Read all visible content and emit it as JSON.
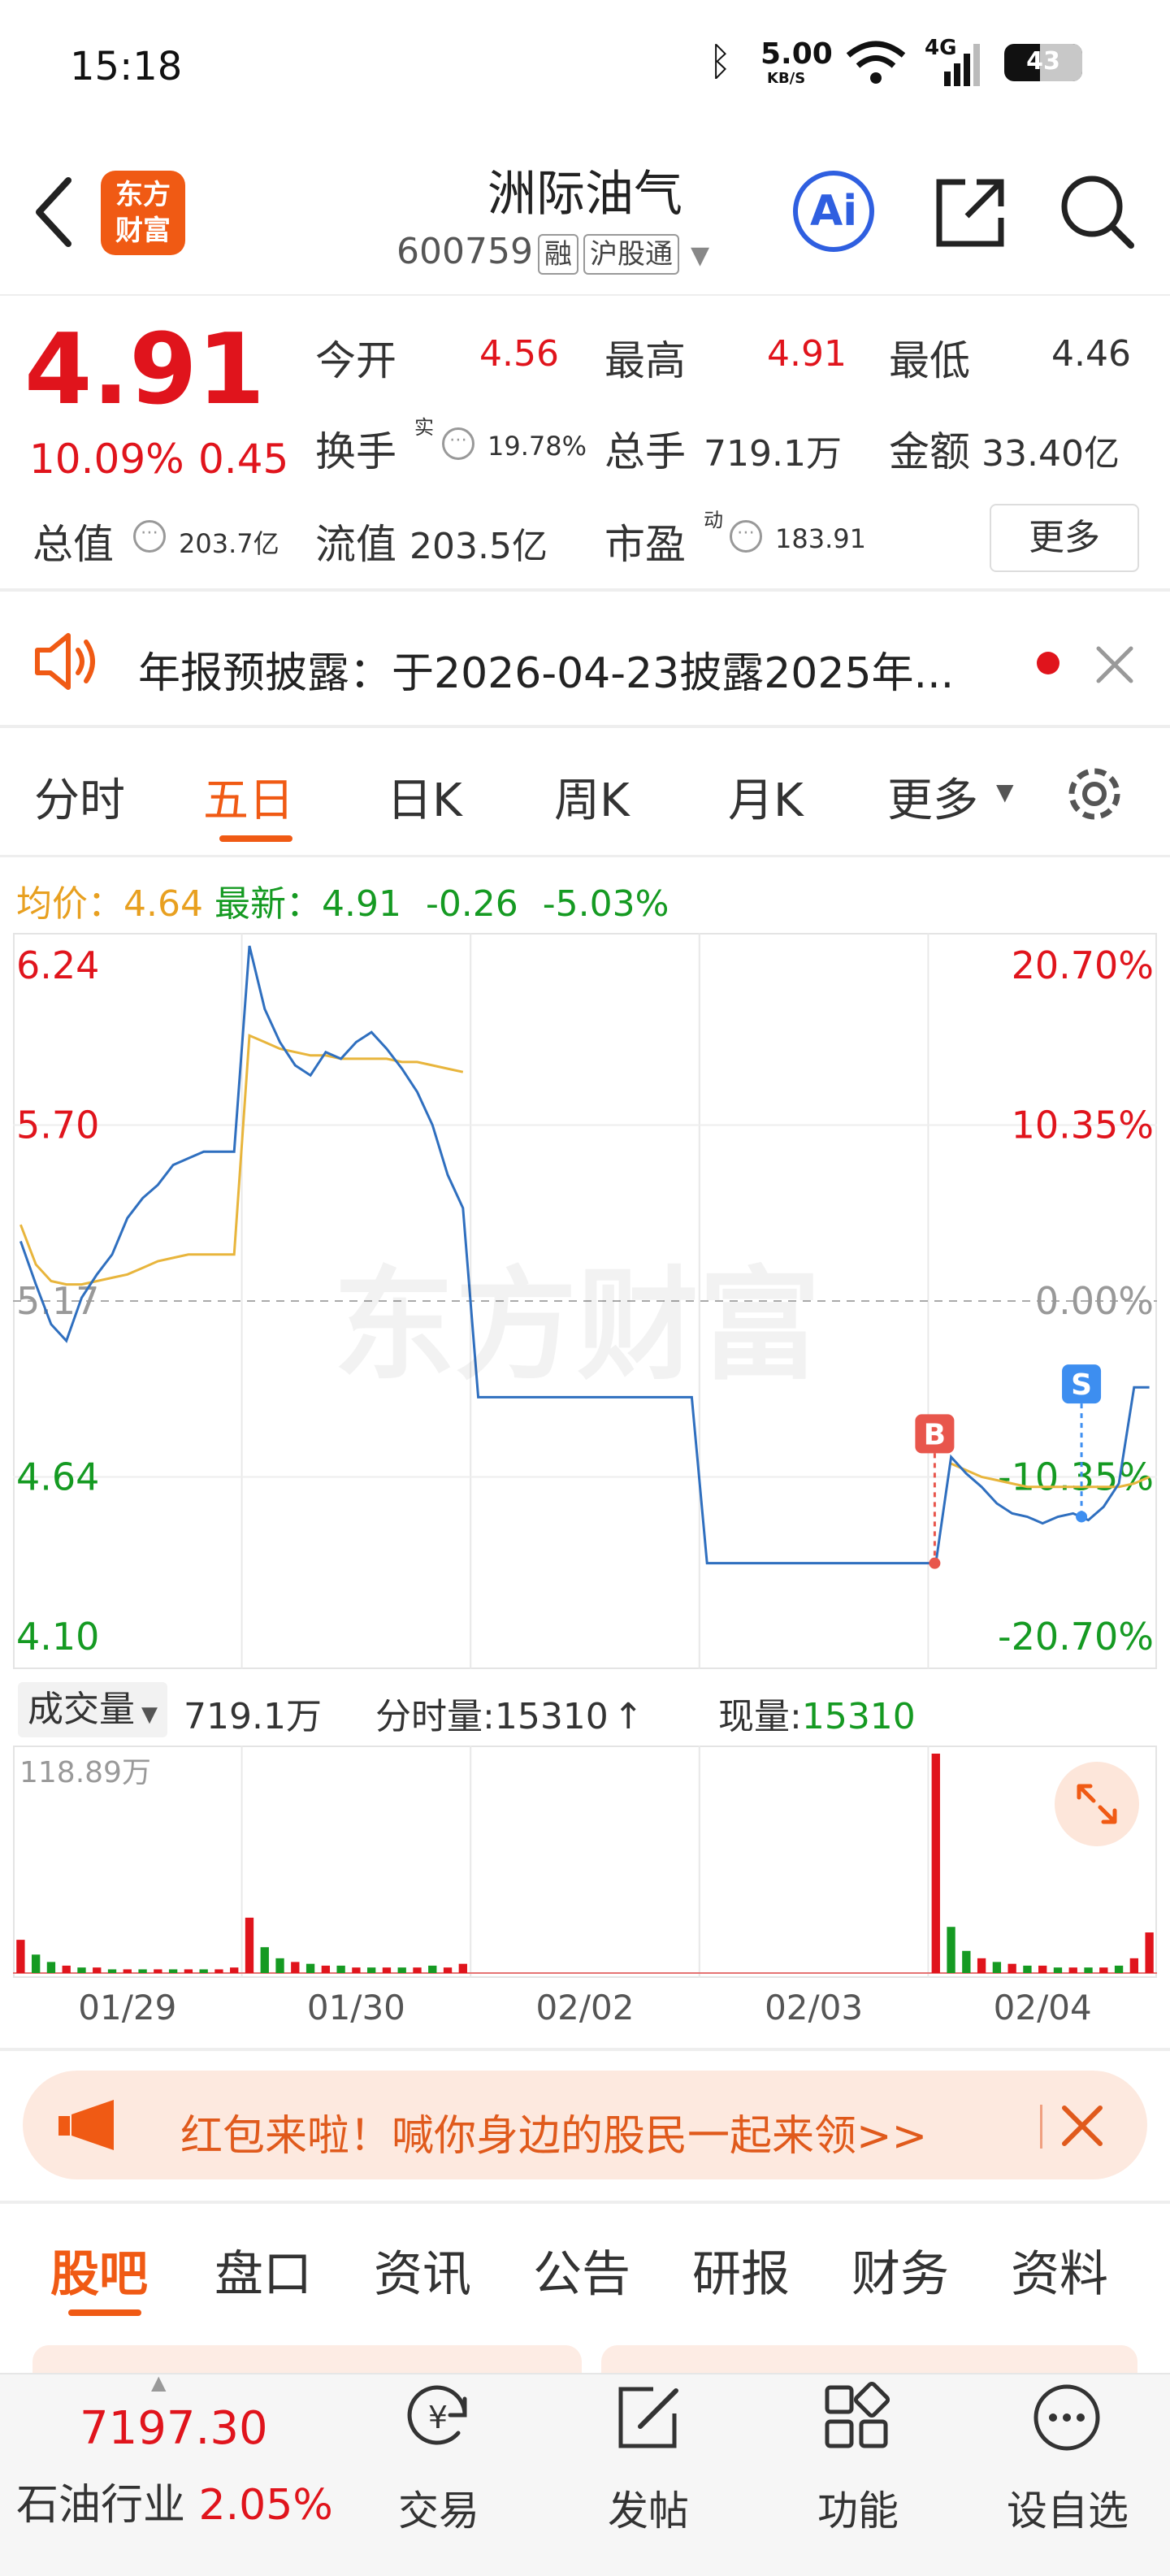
{
  "status_bar": {
    "time": "15:18",
    "net_speed": "5.00",
    "net_unit": "KB/S",
    "signal": "4G",
    "battery": "43"
  },
  "header": {
    "logo": "东方\n财富",
    "stock_name": "洲际油气",
    "stock_code": "600759",
    "badge_1": "融",
    "badge_2": "沪股通",
    "ai_label": "Ai"
  },
  "quote": {
    "price": "4.91",
    "change_pct": "10.09%",
    "change_amt": "0.45",
    "open_label": "今开",
    "open": "4.56",
    "high_label": "最高",
    "high": "4.91",
    "low_label": "最低",
    "low": "4.46",
    "turnover_label": "换手",
    "turnover_sup": "实",
    "turnover": "19.78%",
    "volume_label": "总手",
    "volume": "719.1万",
    "amount_label": "金额",
    "amount": "33.40亿",
    "mktcap_label": "总值",
    "mktcap": "203.7亿",
    "float_label": "流值",
    "float_cap": "203.5亿",
    "pe_label": "市盈",
    "pe_sup": "动",
    "pe": "183.91",
    "more_label": "更多"
  },
  "notice": {
    "text": "年报预披露：于2026-04-23披露2025年..."
  },
  "chart_tabs": [
    "分时",
    "五日",
    "日K",
    "周K",
    "月K",
    "更多"
  ],
  "active_tab": "五日",
  "chart_info": {
    "avg_label": "均价：",
    "avg": "4.64",
    "latest_label": "最新：",
    "latest": "4.91",
    "change": "-0.26",
    "change_pct": "-5.03%"
  },
  "chart_data": {
    "type": "line",
    "title": "",
    "days": [
      "01/29",
      "01/30",
      "02/02",
      "02/03",
      "02/04"
    ],
    "price_axis": [
      "6.24",
      "5.70",
      "5.17",
      "4.64",
      "4.10"
    ],
    "pct_axis": [
      "20.70%",
      "10.35%",
      "0.00%",
      "-10.35%",
      "-20.70%"
    ],
    "ylim": [
      4.1,
      6.24
    ],
    "reference_price": 5.17,
    "series": [
      {
        "name": "价格",
        "values": [
          5.35,
          5.22,
          5.1,
          5.05,
          5.18,
          5.25,
          5.31,
          5.42,
          5.48,
          5.52,
          5.58,
          5.6,
          5.62,
          5.62,
          5.62,
          6.24,
          6.05,
          5.95,
          5.88,
          5.85,
          5.92,
          5.9,
          5.95,
          5.98,
          5.93,
          5.87,
          5.8,
          5.7,
          5.55,
          5.45,
          4.88,
          4.88,
          4.88,
          4.88,
          4.88,
          4.88,
          4.88,
          4.88,
          4.88,
          4.88,
          4.88,
          4.88,
          4.88,
          4.88,
          4.88,
          4.38,
          4.38,
          4.38,
          4.38,
          4.38,
          4.38,
          4.38,
          4.38,
          4.38,
          4.38,
          4.38,
          4.38,
          4.38,
          4.38,
          4.38,
          4.38,
          4.7,
          4.65,
          4.61,
          4.56,
          4.53,
          4.52,
          4.5,
          4.52,
          4.53,
          4.51,
          4.55,
          4.62,
          4.91,
          4.91
        ]
      },
      {
        "name": "均价",
        "values": [
          5.4,
          5.28,
          5.23,
          5.22,
          5.22,
          5.23,
          5.24,
          5.25,
          5.27,
          5.29,
          5.3,
          5.31,
          5.31,
          5.31,
          5.31,
          5.97,
          5.95,
          5.93,
          5.92,
          5.91,
          5.91,
          5.9,
          5.9,
          5.9,
          5.9,
          5.89,
          5.89,
          5.88,
          5.87,
          5.86,
          null,
          null,
          null,
          null,
          null,
          null,
          null,
          null,
          null,
          null,
          null,
          null,
          null,
          null,
          null,
          null,
          null,
          null,
          null,
          null,
          null,
          null,
          null,
          null,
          null,
          null,
          null,
          null,
          null,
          null,
          null,
          4.68,
          4.66,
          4.64,
          4.63,
          4.62,
          4.61,
          4.61,
          4.61,
          4.61,
          4.61,
          4.61,
          4.61,
          4.62,
          4.64
        ]
      }
    ],
    "markers": [
      {
        "label": "B",
        "day": "02/04",
        "price": 4.38
      },
      {
        "label": "S",
        "day": "02/04",
        "price": 4.52
      }
    ]
  },
  "volume_bar": {
    "label": "成交量",
    "total": "719.1万",
    "minute_label": "分时量:",
    "minute": "15310",
    "current_label": "现量:",
    "current": "15310",
    "max_label": "118.89万"
  },
  "volume_data": {
    "unit": "万",
    "ylim": [
      0,
      118.89
    ],
    "values": [
      18,
      10,
      6,
      4,
      3,
      3,
      2,
      2,
      2,
      2,
      2,
      2,
      2,
      2,
      3,
      30,
      14,
      8,
      6,
      5,
      4,
      4,
      3,
      3,
      3,
      3,
      3,
      4,
      3,
      5,
      0,
      0,
      0,
      0,
      0,
      0,
      0,
      0,
      0,
      0,
      0,
      0,
      0,
      0,
      0,
      0,
      0,
      0,
      0,
      0,
      0,
      0,
      0,
      0,
      0,
      0,
      0,
      0,
      0,
      0,
      118.89,
      25,
      12,
      8,
      6,
      5,
      4,
      4,
      3,
      3,
      3,
      3,
      4,
      8,
      22
    ],
    "colors": [
      "red",
      "green",
      "green",
      "red",
      "green",
      "red",
      "green",
      "red",
      "green",
      "red",
      "green",
      "red",
      "green",
      "red",
      "red",
      "red",
      "green",
      "green",
      "red",
      "green",
      "red",
      "green",
      "red",
      "green",
      "red",
      "green",
      "red",
      "green",
      "red",
      "red",
      "red",
      "red",
      "red",
      "red",
      "red",
      "red",
      "red",
      "red",
      "red",
      "red",
      "red",
      "red",
      "red",
      "red",
      "red",
      "red",
      "red",
      "red",
      "red",
      "red",
      "red",
      "red",
      "red",
      "red",
      "red",
      "red",
      "red",
      "red",
      "red",
      "red",
      "red",
      "green",
      "green",
      "red",
      "green",
      "red",
      "green",
      "red",
      "green",
      "red",
      "green",
      "red",
      "green",
      "red",
      "red"
    ]
  },
  "promo": {
    "text": "红包来啦！喊你身边的股民一起来领>>"
  },
  "bottom_tabs": [
    "股吧",
    "盘口",
    "资讯",
    "公告",
    "研报",
    "财务",
    "资料"
  ],
  "bottom_active": "股吧",
  "bottom_nav": {
    "index_value": "7197.30",
    "index_name": "石油行业",
    "index_change": "2.05%",
    "items": [
      "交易",
      "发帖",
      "功能",
      "设自选"
    ]
  },
  "colors": {
    "up": "#e0141c",
    "down": "#159a22",
    "accent": "#f05a14",
    "price_line": "#2f6fbf",
    "avg_line": "#e8b53c"
  }
}
